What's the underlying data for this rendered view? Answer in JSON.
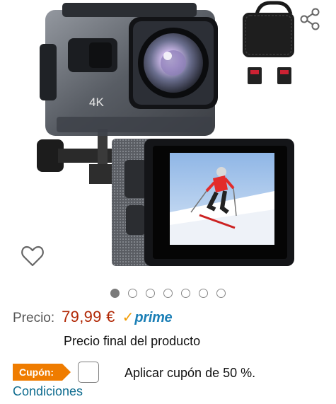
{
  "product": {
    "camera_badge_text": "4K",
    "image_count": 7,
    "active_image_index": 0
  },
  "icons": {
    "share": "share-icon",
    "favorite": "heart-icon"
  },
  "price": {
    "label": "Precio:",
    "value": "79,99 €",
    "prime_check": "✓",
    "prime_text": "prime"
  },
  "final_price_note": "Precio final del producto",
  "coupon": {
    "badge": "Cupón:",
    "text": "Aplicar cupón de 50 %.",
    "checked": false
  },
  "conditions_link": "Condiciones",
  "colors": {
    "price": "#b12704",
    "prime_blue": "#1b7fb6",
    "prime_check": "#f29a00",
    "coupon_badge": "#ef7c00",
    "link": "#0f6c8f"
  }
}
